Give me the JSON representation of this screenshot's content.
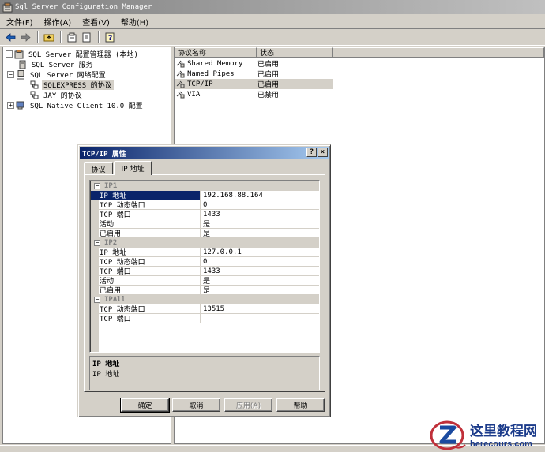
{
  "window": {
    "title": "Sql Server Configuration Manager"
  },
  "menu": [
    {
      "label": "文件(F)"
    },
    {
      "label": "操作(A)"
    },
    {
      "label": "查看(V)"
    },
    {
      "label": "帮助(H)"
    }
  ],
  "tree": {
    "root": "SQL Server 配置管理器 (本地)",
    "services": "SQL Server 服务",
    "network": "SQL Server 网络配置",
    "sqlexpress": "SQLEXPRESS 的协议",
    "jay": "JAY 的协议",
    "native": "SQL Native Client 10.0 配置"
  },
  "protocols": {
    "headers": [
      "协议名称",
      "状态"
    ],
    "rows": [
      {
        "name": "Shared Memory",
        "status": "已启用"
      },
      {
        "name": "Named Pipes",
        "status": "已启用"
      },
      {
        "name": "TCP/IP",
        "status": "已启用"
      },
      {
        "name": "VIA",
        "status": "已禁用"
      }
    ]
  },
  "dialog": {
    "title": "TCP/IP 属性",
    "help_btn": "?",
    "close_btn": "×",
    "tabs": [
      "协议",
      "IP 地址"
    ],
    "groups": [
      {
        "name": "IP1",
        "props": [
          {
            "k": "IP 地址",
            "v": "192.168.88.164"
          },
          {
            "k": "TCP 动态端口",
            "v": "0"
          },
          {
            "k": "TCP 端口",
            "v": "1433"
          },
          {
            "k": "活动",
            "v": "是"
          },
          {
            "k": "已启用",
            "v": "是"
          }
        ]
      },
      {
        "name": "IP2",
        "props": [
          {
            "k": "IP 地址",
            "v": "127.0.0.1"
          },
          {
            "k": "TCP 动态端口",
            "v": "0"
          },
          {
            "k": "TCP 端口",
            "v": "1433"
          },
          {
            "k": "活动",
            "v": "是"
          },
          {
            "k": "已启用",
            "v": "是"
          }
        ]
      },
      {
        "name": "IPAll",
        "props": [
          {
            "k": "TCP 动态端口",
            "v": "13515"
          },
          {
            "k": "TCP 端口",
            "v": ""
          }
        ]
      }
    ],
    "description": {
      "title": "IP 地址",
      "text": "IP 地址"
    },
    "buttons": {
      "ok": "确定",
      "cancel": "取消",
      "apply": "应用(A)",
      "help": "帮助"
    }
  },
  "watermark": {
    "text": "这里教程网",
    "url": "herecours.com"
  }
}
